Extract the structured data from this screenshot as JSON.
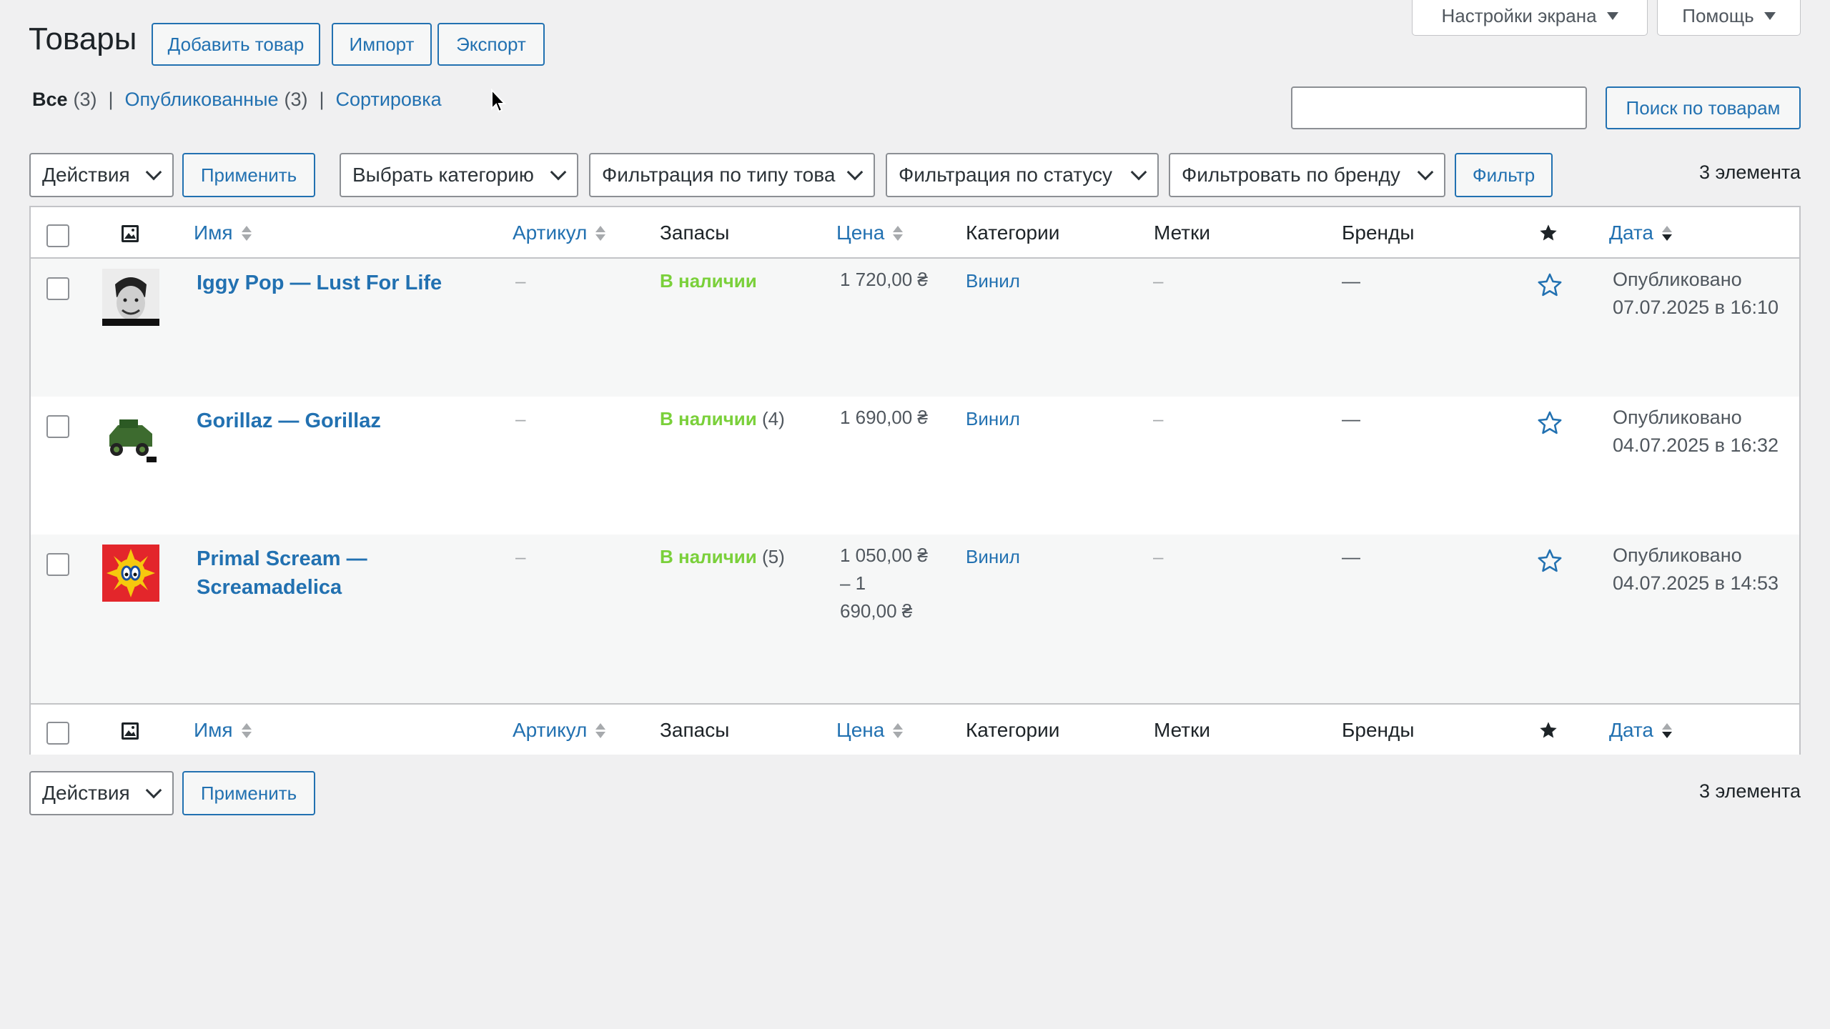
{
  "screen_options": {
    "label": "Настройки экрана"
  },
  "help": {
    "label": "Помощь"
  },
  "header": {
    "title": "Товары",
    "add_label": "Добавить товар",
    "import_label": "Импорт",
    "export_label": "Экспорт"
  },
  "views": {
    "all_label": "Все",
    "all_count": "(3)",
    "published_label": "Опубликованные",
    "published_count": "(3)",
    "sort_label": "Сортировка",
    "separator": "|"
  },
  "search": {
    "value": "",
    "button_label": "Поиск по товарам"
  },
  "filters": {
    "bulk_action": "Действия",
    "apply_label": "Применить",
    "category": "Выбрать категорию",
    "product_type": "Фильтрация по типу това",
    "stock_status": "Фильтрация по статусу",
    "brand": "Фильтровать по бренду",
    "filter_label": "Фильтр",
    "items_count": "3 элемента"
  },
  "columns": {
    "name": "Имя",
    "sku": "Артикул",
    "stock": "Запасы",
    "price": "Цена",
    "categories": "Категории",
    "tags": "Метки",
    "brands": "Бренды",
    "date": "Дата"
  },
  "products": [
    {
      "name": "Iggy Pop — Lust For Life",
      "sku": "–",
      "stock": "В наличии",
      "stock_qty": "",
      "price": "1 720,00 ₴",
      "category": "Винил",
      "tags": "–",
      "brands": "—",
      "date_status": "Опубликовано",
      "date": "07.07.2025 в 16:10"
    },
    {
      "name": "Gorillaz — Gorillaz",
      "sku": "–",
      "stock": "В наличии",
      "stock_qty": "(4)",
      "price": "1 690,00 ₴",
      "category": "Винил",
      "tags": "–",
      "brands": "—",
      "date_status": "Опубликовано",
      "date": "04.07.2025 в 16:32"
    },
    {
      "name_line1": "Primal Scream —",
      "name_line2": "Screamadelica",
      "sku": "–",
      "stock": "В наличии",
      "stock_qty": "(5)",
      "price_line1": "1 050,00 ₴",
      "price_line2": "– 1",
      "price_line3": "690,00 ₴",
      "category": "Винил",
      "tags": "–",
      "brands": "—",
      "date_status": "Опубликовано",
      "date": "04.07.2025 в 14:53"
    }
  ],
  "bottom": {
    "bulk_action": "Действия",
    "apply_label": "Применить",
    "items_count": "3 элемента"
  },
  "colors": {
    "accent": "#2271b1",
    "in_stock": "#7ad03a",
    "background": "#f0f0f1"
  },
  "icons": {
    "image_column": "image-icon",
    "featured_column": "star-icon",
    "featured_toggle": "star-outline-icon"
  }
}
